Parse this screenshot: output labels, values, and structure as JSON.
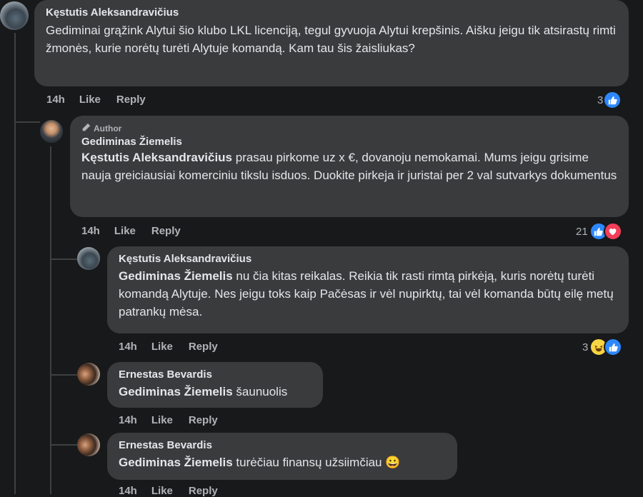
{
  "comments": [
    {
      "author": "Kęstutis Aleksandravičius",
      "text": "Gediminai grąžink Alytui šio klubo LKL licenciją, tegul gyvuoja Alytui krepšinis. Aišku jeigu tik atsirastų rimti žmonės, kurie norėtų turėti Alytuje komandą. Kam tau šis žaisliukas?",
      "time": "14h",
      "like": "Like",
      "reply": "Reply",
      "reactions": "3"
    },
    {
      "badge": "Author",
      "author": "Gediminas Žiemelis",
      "mention": "Kęstutis Aleksandravičius",
      "text": " prasau pirkome uz x €, dovanoju nemokamai. Mums jeigu grisime nauja greiciausiai komerciniu tikslu isduos. Duokite pirkeja ir juristai per 2 val sutvarkys dokumentus",
      "time": "14h",
      "like": "Like",
      "reply": "Reply",
      "reactions": "21"
    },
    {
      "author": "Kęstutis Aleksandravičius",
      "mention": "Gediminas Žiemelis",
      "text": " nu čia kitas reikalas. Reikia tik rasti rimtą pirkėją, kuris norėtų turėti komandą Alytuje. Nes jeigu toks kaip Pačėsas ir vėl nupirktų, tai vėl komanda būtų eilę metų patrankų mėsa.",
      "time": "14h",
      "like": "Like",
      "reply": "Reply",
      "reactions": "3"
    },
    {
      "author": "Ernestas Bevardis",
      "mention": "Gediminas Žiemelis",
      "text": " šaunuolis",
      "time": "14h",
      "like": "Like",
      "reply": "Reply"
    },
    {
      "author": "Ernestas Bevardis",
      "mention": "Gediminas Žiemelis",
      "text": " turėčiau finansų užsiimčiau 😀",
      "time": "14h",
      "like": "Like",
      "reply": "Reply"
    }
  ],
  "colors": {
    "background": "#18191a",
    "bubble": "#3a3b3c",
    "like": "#2d88ff",
    "love": "#f33e58",
    "haha": "#f7d443"
  },
  "icons": {
    "like": "like-icon",
    "love": "love-icon",
    "haha": "haha-icon",
    "author_badge": "pencil-icon"
  }
}
